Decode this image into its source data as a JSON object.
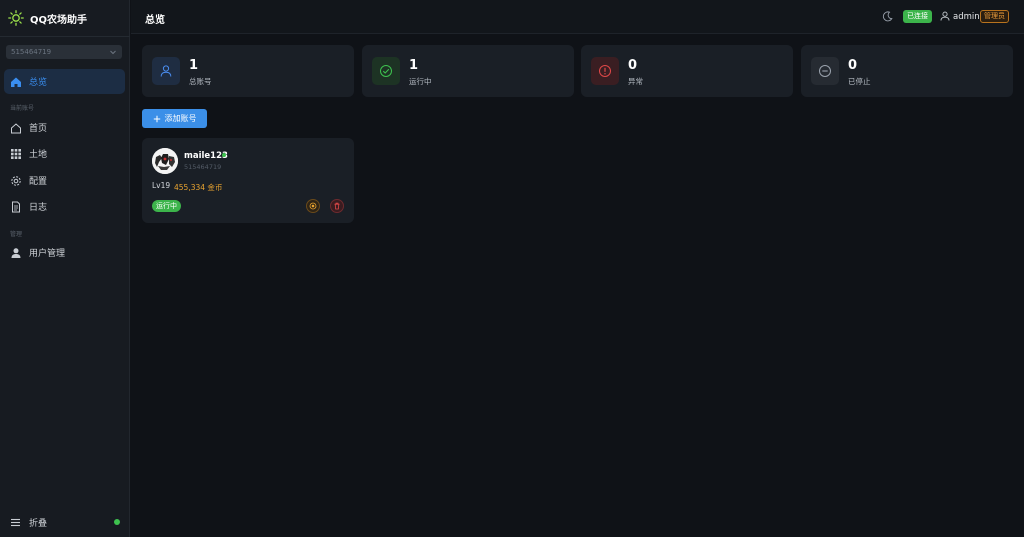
{
  "app": {
    "title": "QQ农场助手"
  },
  "sidebar": {
    "account_select": "515464719",
    "items": [
      {
        "label": "总览",
        "icon": "home-icon"
      },
      {
        "label": "首页",
        "icon": "house-outline-icon"
      },
      {
        "label": "土地",
        "icon": "grid-icon"
      },
      {
        "label": "配置",
        "icon": "gear-icon"
      },
      {
        "label": "日志",
        "icon": "document-icon"
      },
      {
        "label": "用户管理",
        "icon": "user-icon"
      }
    ],
    "section_account": "当前账号",
    "section_manage": "管理",
    "collapse_label": "折叠"
  },
  "header": {
    "title": "总览",
    "connection_status": "已连接",
    "username": "admin",
    "role": "管理员"
  },
  "stats": [
    {
      "value": "1",
      "label": "总账号",
      "color": "#4a8df0"
    },
    {
      "value": "1",
      "label": "运行中",
      "color": "#3ec24f"
    },
    {
      "value": "0",
      "label": "异常",
      "color": "#e04848"
    },
    {
      "value": "0",
      "label": "已停止",
      "color": "#9aa2ad"
    }
  ],
  "add_button": "添加账号",
  "accounts": [
    {
      "name": "maile123",
      "id": "515464719",
      "level": "Lv19",
      "gold": "455,334 金币",
      "status": "运行中"
    }
  ],
  "colors": {
    "accent": "#3b8fe8",
    "success": "#3cb44b",
    "warning": "#e8a330",
    "danger": "#e04848"
  }
}
